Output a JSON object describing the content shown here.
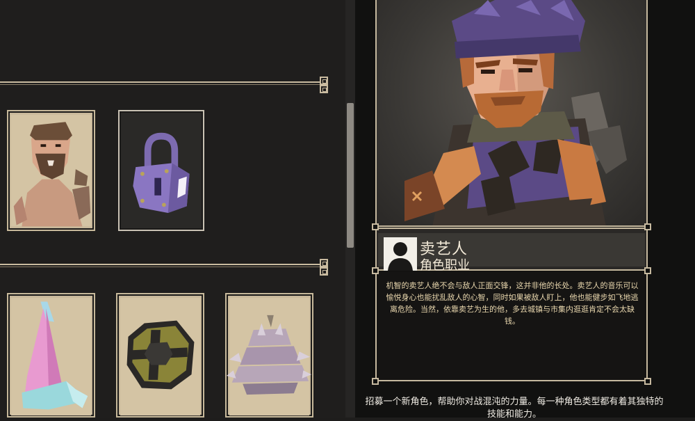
{
  "hero": {
    "name": "卖艺人",
    "type_label": "角色职业",
    "description": "机智的卖艺人绝不会与敌人正面交锋，这并非他的长处。卖艺人的音乐可以愉悦身心也能扰乱敌人的心智，同时如果被敌人盯上，他也能健步如飞地逃离危险。当然，依靠卖艺为生的他，多去城镇与市集内逛逛肯定不会太缺钱。"
  },
  "footer": {
    "text": "招募一个新角色，帮助你对战混沌的力量。每一种角色类型都有着其独特的技能和能力。"
  },
  "rows": [
    {
      "items": [
        {
          "icon": "bearded-man-portrait-icon",
          "state": "unlocked",
          "selected": false
        },
        {
          "icon": "padlock-icon",
          "state": "locked",
          "selected": false
        }
      ]
    },
    {
      "items": [
        {
          "icon": "pink-hat-icon",
          "state": "unlocked"
        },
        {
          "icon": "round-shield-icon",
          "state": "unlocked"
        },
        {
          "icon": "spiked-helmet-icon",
          "state": "unlocked"
        }
      ]
    }
  ],
  "colors": {
    "frame": "#c6b99f",
    "parchment": "#c8b89a",
    "desc_text": "#e9d7ae",
    "accent_purple": "#5b4a86"
  }
}
